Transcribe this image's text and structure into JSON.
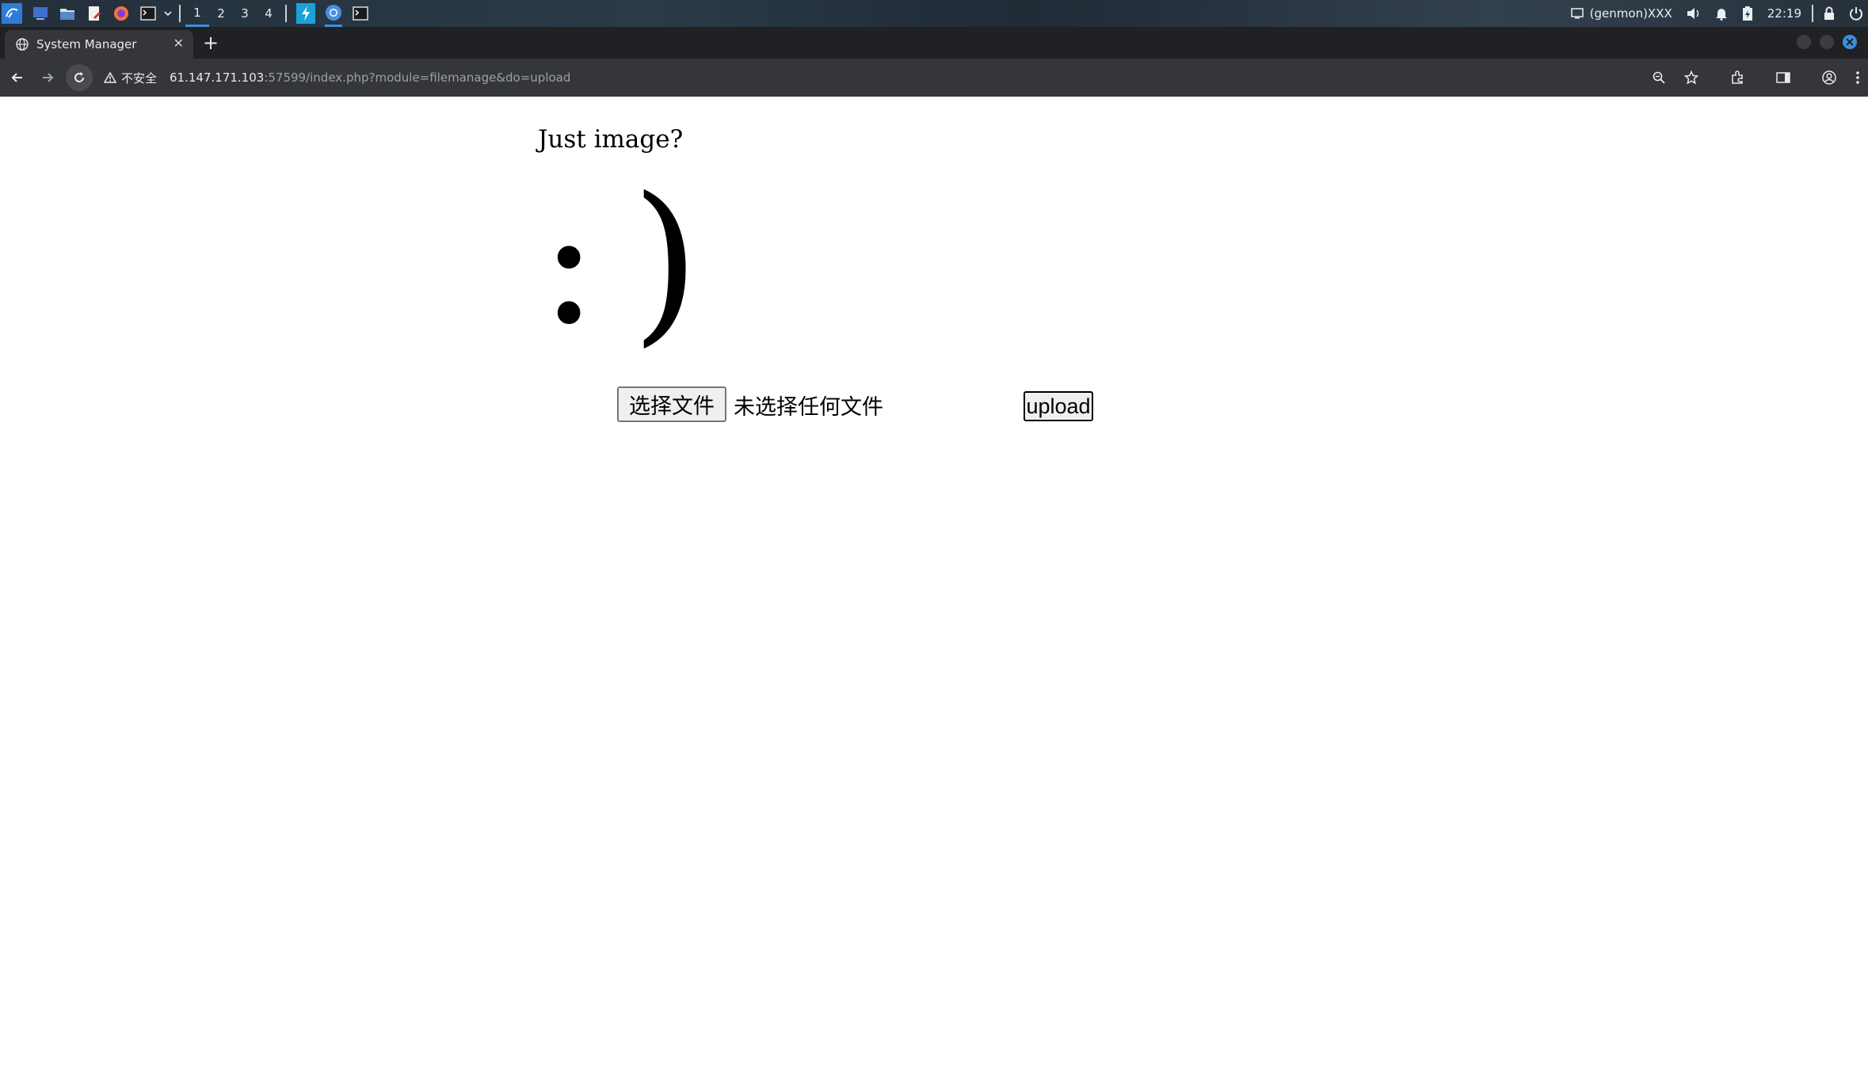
{
  "taskbar": {
    "workspaces": [
      "1",
      "2",
      "3",
      "4"
    ],
    "active_workspace": "1",
    "genmon_label": "(genmon)XXX",
    "clock": "22:19"
  },
  "browser": {
    "tab_title": "System Manager",
    "new_tab_symbol": "+",
    "security_label": "不安全",
    "url_host": "61.147.171.103",
    "url_rest": ":57599/index.php?module=filemanage&do=upload"
  },
  "page": {
    "heading": "Just image?",
    "smiley": ":)",
    "file_button_label": "选择文件",
    "file_status": "未选择任何文件",
    "upload_button_label": "upload"
  },
  "colors": {
    "accent": "#3d8fe0",
    "browser_toolbar": "#35363a",
    "tabstrip": "#202124",
    "close_window": "#3d8fe0"
  }
}
